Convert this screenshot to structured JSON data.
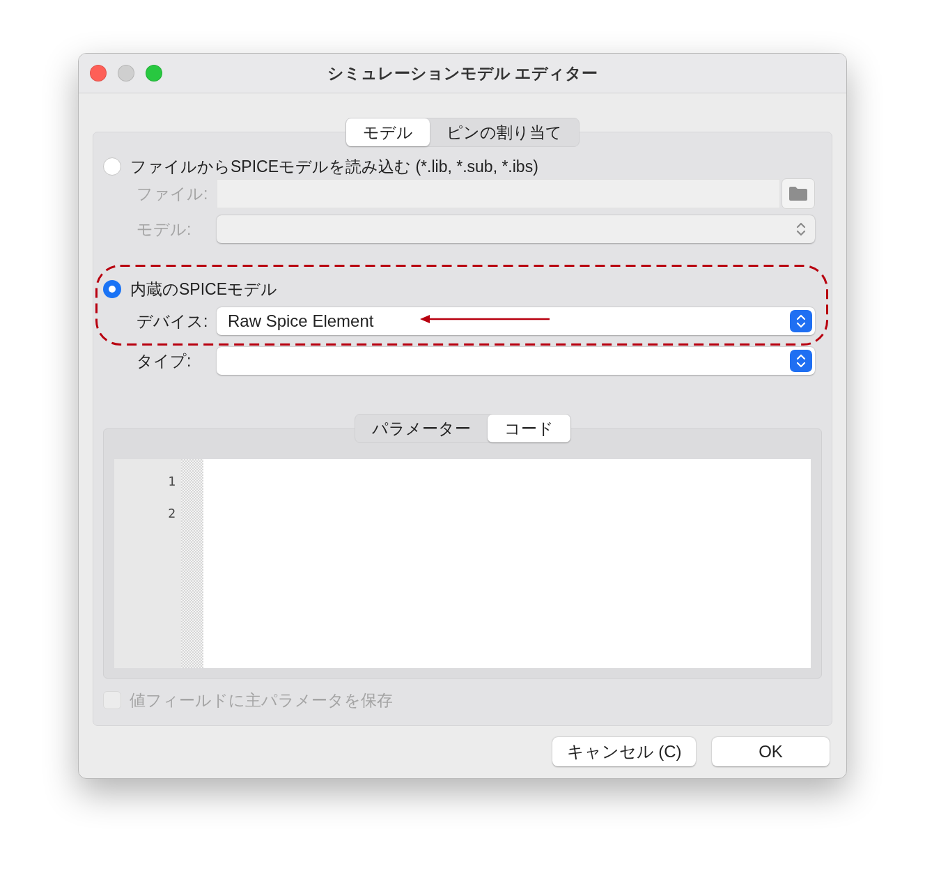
{
  "window": {
    "title": "シミュレーションモデル エディター"
  },
  "tabs": [
    {
      "label": "モデル",
      "selected": true
    },
    {
      "label": "ピンの割り当て",
      "selected": false
    }
  ],
  "sources": [
    {
      "label": "ファイルからSPICEモデルを読み込む (*.lib, *.sub, *.ibs)",
      "selected": false,
      "fields": [
        {
          "kind": "file",
          "label": "ファイル:",
          "disabled": true
        },
        {
          "kind": "select",
          "label": "モデル:",
          "disabled": true
        }
      ]
    },
    {
      "label": "内蔵のSPICEモデル",
      "selected": true,
      "fields": [
        {
          "kind": "select",
          "label": "デバイス:",
          "value": "Raw Spice Element",
          "disabled": false
        }
      ]
    }
  ],
  "type_field": {
    "kind": "select",
    "label": "タイプ:",
    "disabled": false
  },
  "code_tabs": [
    {
      "label": "パラメーター",
      "selected": false
    },
    {
      "label": "コード",
      "selected": true
    }
  ],
  "editor": {
    "line_numbers": [
      "1",
      "2"
    ]
  },
  "save_checkbox": {
    "label": "値フィールドに主パラメータを保存",
    "checked": false,
    "disabled": true
  },
  "buttons": [
    "キャンセル (C)",
    "OK"
  ]
}
